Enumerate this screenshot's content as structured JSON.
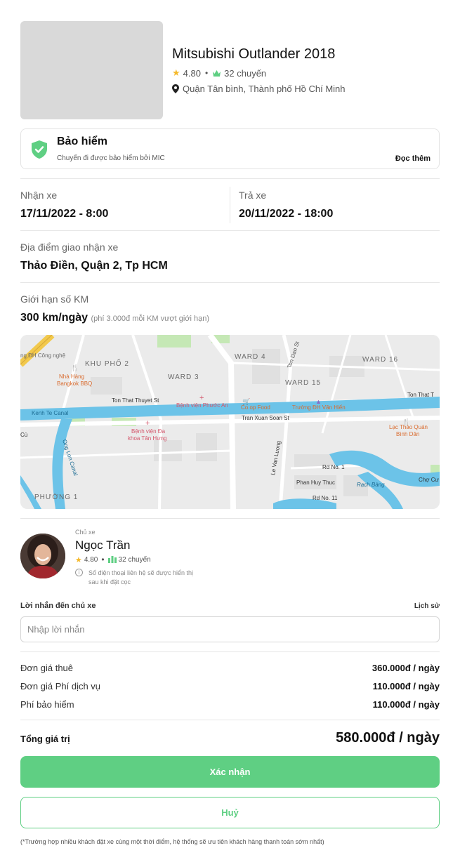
{
  "car": {
    "name": "Mitsubishi Outlander 2018",
    "rating": "4.80",
    "trips": "32 chuyến",
    "location": "Quận Tân bình, Thành phố Hồ Chí Minh"
  },
  "insurance": {
    "title": "Bảo hiểm",
    "subtitle": "Chuyến đi được bảo hiểm bởi MIC",
    "read_more": "Đọc thêm"
  },
  "pickup": {
    "label": "Nhận xe",
    "value": "17/11/2022 - 8:00"
  },
  "return": {
    "label": "Trả xe",
    "value": "20/11/2022 - 18:00"
  },
  "delivery": {
    "label": "Địa điểm giao nhận xe",
    "value": "Thảo Điền, Quận 2, Tp HCM"
  },
  "km_limit": {
    "label": "Giới hạn số KM",
    "value": "300 km/ngày",
    "note": "(phí 3.000đ mỗi KM vượt giới hạn)"
  },
  "map": {
    "labels": {
      "dh_cong_nghe": "ng ĐH Công nghệ",
      "khu_pho_2": "KHU PHỐ 2",
      "nha_hang": "Nhà Hàng",
      "bangkok_bbq": "Bangkok BBQ",
      "ward3": "WARD 3",
      "ward4": "WARD 4",
      "ton_dan": "Ton Dan St",
      "ward16": "WARD 16",
      "ward15": "WARD 15",
      "ton_that_thuyet": "Ton That Thuyet St",
      "ton_that_right": "Ton That T",
      "bv_phuoc_an": "Bệnh viện Phước An",
      "coop_food": "Co.op Food",
      "truong_van_hien": "Trường ĐH Văn Hiến",
      "kenh_te": "Kenh Te Canal",
      "tran_xuan_soan": "Tran Xuan Soan St",
      "bv_da_khoa_1": "Bệnh viện Đa",
      "bv_da_khoa_2": "khoa Tân Hưng",
      "lac_thao_1": "Lạc Thảo Quán",
      "lac_thao_2": "Bình Dân",
      "doi_canal": "Ong Lon Canal",
      "le_van_luong": "Le Van Luong",
      "rd_no1": "Rd No. 1",
      "phan_huy_thuc": "Phan Huy Thuc",
      "rach_bang": "Rạch Bàng",
      "cho_cu": "Chợ Cư",
      "rd_no11": "Rd No. 11",
      "phuong1": "PHƯỜNG 1",
      "cu": "Cù"
    }
  },
  "owner": {
    "role": "Chủ xe",
    "name": "Ngọc Trần",
    "rating": "4.80",
    "trips": "32 chuyến",
    "info": "Số điện thoại liên hệ sẽ được hiển thị sau khi đặt cọc"
  },
  "message": {
    "label": "Lời nhắn đến chủ xe",
    "history": "Lịch sử",
    "placeholder": "Nhập lời nhắn"
  },
  "prices": [
    {
      "label": "Đơn giá thuê",
      "value": "360.000đ / ngày"
    },
    {
      "label": "Đơn giá Phí dịch vụ",
      "value": "110.000đ / ngày"
    },
    {
      "label": "Phí bảo hiểm",
      "value": "110.000đ / ngày"
    }
  ],
  "total": {
    "label": "Tổng giá trị",
    "value": "580.000đ / ngày"
  },
  "buttons": {
    "confirm": "Xác nhận",
    "cancel": "Huỷ"
  },
  "footnote": "(*Trường hợp nhiều khách đặt xe cùng một thời điểm, hệ thống sẽ ưu tiên khách hàng thanh toán sớm nhất)",
  "colors": {
    "accent": "#5fcf83",
    "star": "#f5b92b",
    "water": "#6cc3e8"
  }
}
